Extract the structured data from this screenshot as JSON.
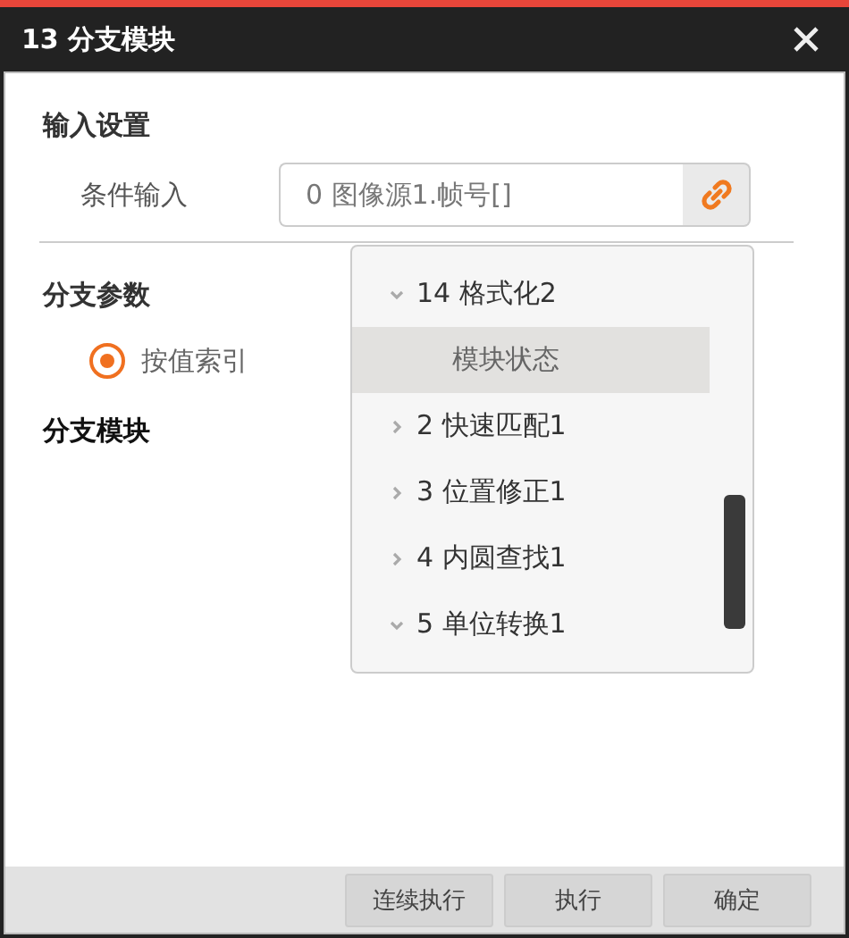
{
  "window": {
    "title": "13 分支模块"
  },
  "input_settings": {
    "heading": "输入设置",
    "condition": {
      "label": "条件输入",
      "value": "0 图像源1.帧号[]"
    }
  },
  "branch_params": {
    "heading": "分支参数",
    "radio": {
      "label": "按值索引",
      "selected": true
    }
  },
  "branch_module": {
    "heading": "分支模块"
  },
  "dropdown": {
    "items": [
      {
        "label": "14 格式化2",
        "expanded": true,
        "selected": false,
        "children": [
          {
            "label": "模块状态",
            "selected": true
          }
        ]
      },
      {
        "label": "2 快速匹配1",
        "expanded": false,
        "selected": false
      },
      {
        "label": "3 位置修正1",
        "expanded": false,
        "selected": false
      },
      {
        "label": "4 内圆查找1",
        "expanded": false,
        "selected": false
      },
      {
        "label": "5 单位转换1",
        "expanded": true,
        "selected": false
      }
    ]
  },
  "buttons": [
    "连续执行",
    "执行",
    "确定"
  ]
}
